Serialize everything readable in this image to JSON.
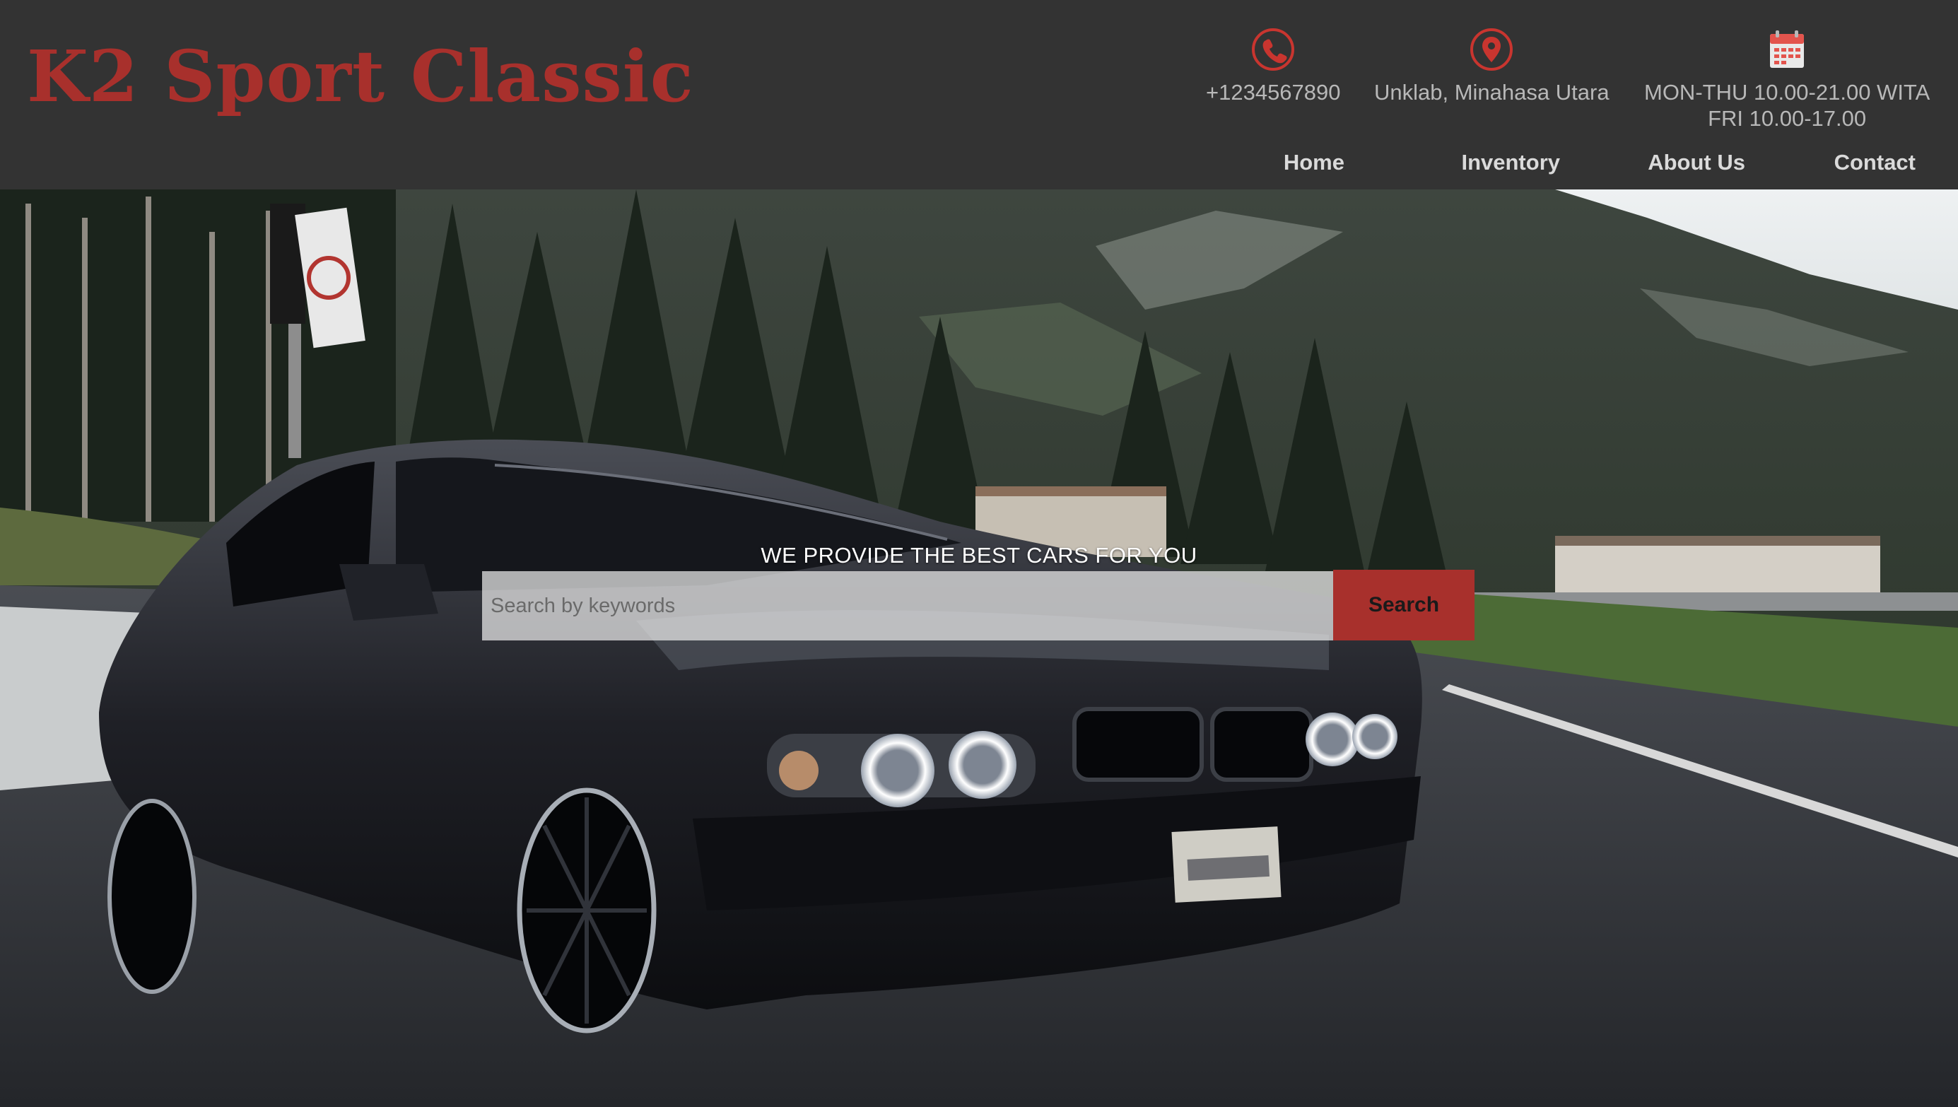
{
  "brand": {
    "name": "K2 Sport Classic",
    "color": "#a8302c"
  },
  "contact": {
    "phone": {
      "icon": "phone-icon",
      "text": "+1234567890"
    },
    "address": {
      "icon": "map-pin-icon",
      "text": "Unklab, Minahasa Utara"
    },
    "hours": {
      "icon": "calendar-icon",
      "line1": "MON-THU 10.00-21.00 WITA",
      "line2": "FRI 10.00-17.00"
    }
  },
  "nav": {
    "home": "Home",
    "inventory": "Inventory",
    "about": "About Us",
    "contact": "Contact"
  },
  "hero": {
    "tagline": "WE PROVIDE THE BEST CARS FOR YOU",
    "search_placeholder": "Search by keywords",
    "search_button": "Search",
    "background": "black sedan parked on mountain road with pine forest"
  },
  "colors": {
    "header_bg": "#333333",
    "accent": "#a8302c",
    "info_text": "#b8b8b8",
    "nav_text": "#dadada"
  }
}
